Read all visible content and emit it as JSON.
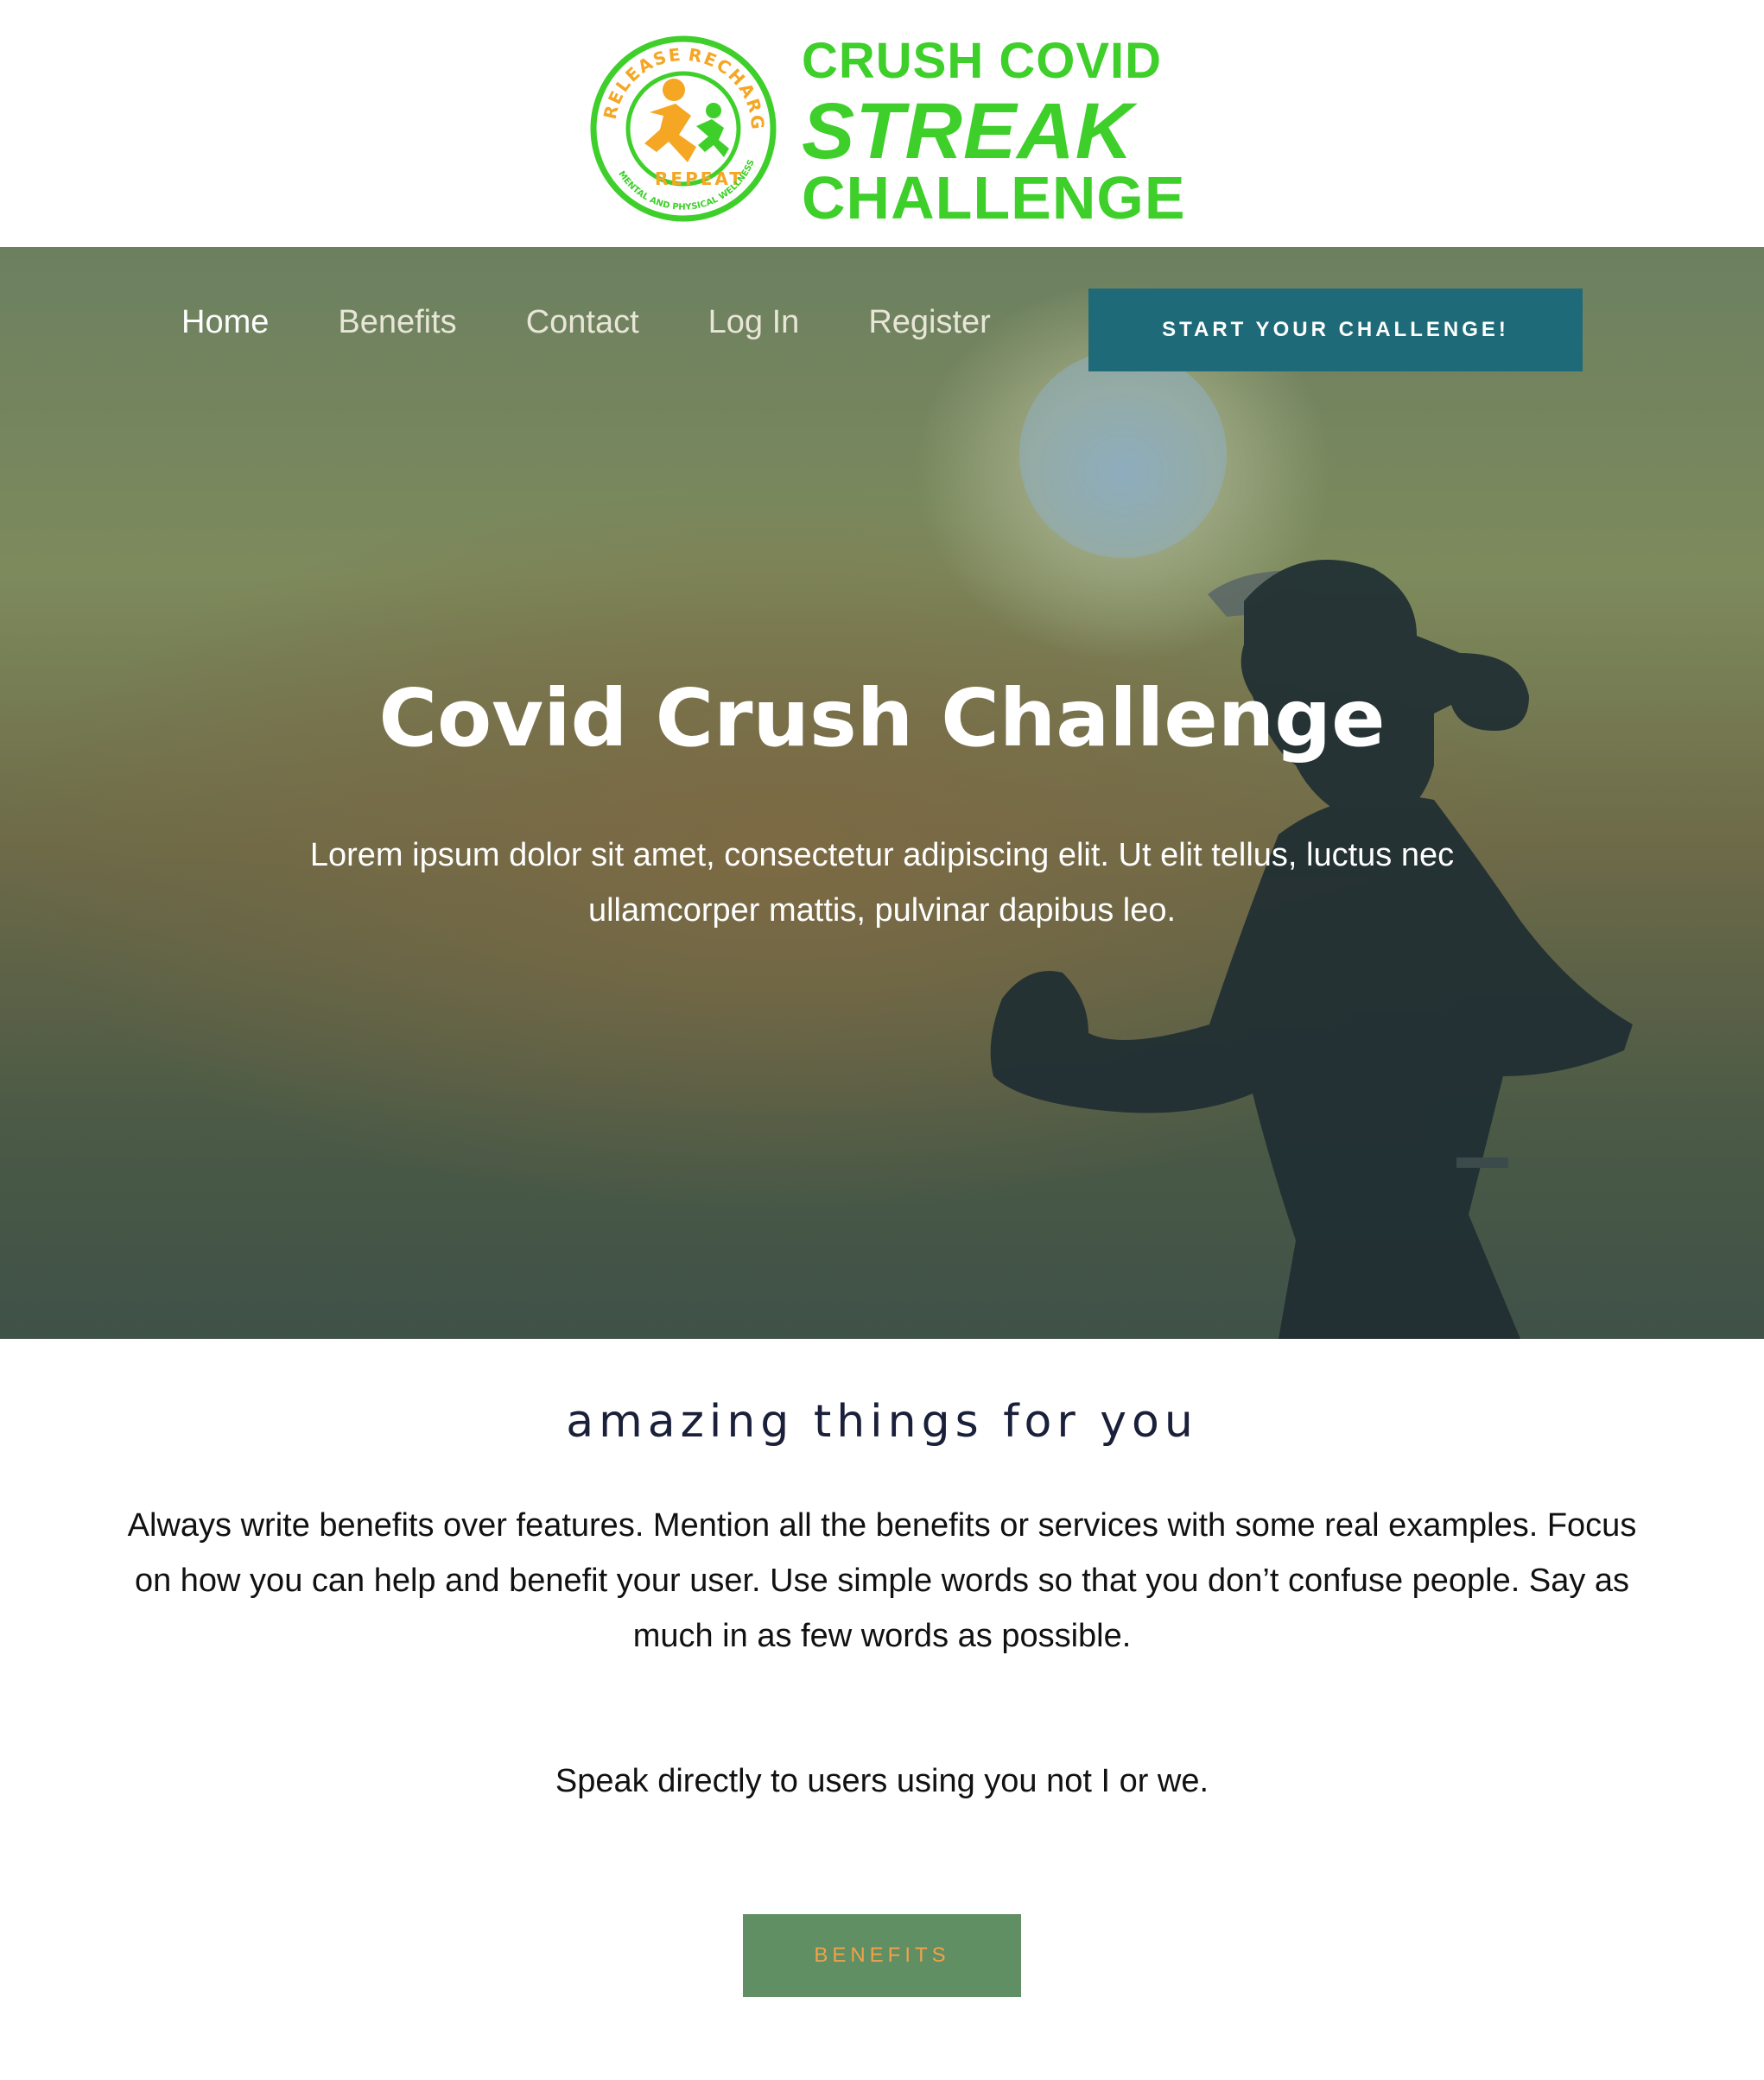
{
  "brand": {
    "badge_ring_top": "RELEASE",
    "badge_ring_right": "RECHARGE",
    "badge_ring_bottom": "REPEAT",
    "badge_tagline": "MENTAL AND PHYSICAL WELLNESS",
    "line1": "CRUSH COVID",
    "line2": "STREAK",
    "line3": "CHALLENGE",
    "colors": {
      "green": "#3ecf2a",
      "orange": "#f5a623"
    }
  },
  "nav": {
    "items": [
      {
        "label": "Home",
        "active": true
      },
      {
        "label": "Benefits",
        "active": false
      },
      {
        "label": "Contact",
        "active": false
      },
      {
        "label": "Log In",
        "active": false
      },
      {
        "label": "Register",
        "active": false
      }
    ],
    "cta_label": "START YOUR CHALLENGE!"
  },
  "hero": {
    "title": "Covid Crush Challenge",
    "subtitle": "Lorem ipsum dolor sit amet, consectetur adipiscing elit. Ut elit tellus, luctus nec ullamcorper mattis, pulvinar dapibus leo."
  },
  "benefits_section": {
    "heading": "amazing things for you",
    "body": "Always write benefits over features. Mention all the benefits or services with some real examples. Focus on how you can help and benefit your user. Use simple words so that you don’t confuse people. Say as much in as few words as possible.",
    "note": "Speak directly to users using you not I or we.",
    "button_label": "BENEFITS"
  },
  "colors": {
    "cta_bg": "#1e6a79",
    "benefits_button_bg": "#5f8f63",
    "benefits_button_text": "#f0a24a",
    "heading_text": "#1a1f3a"
  }
}
